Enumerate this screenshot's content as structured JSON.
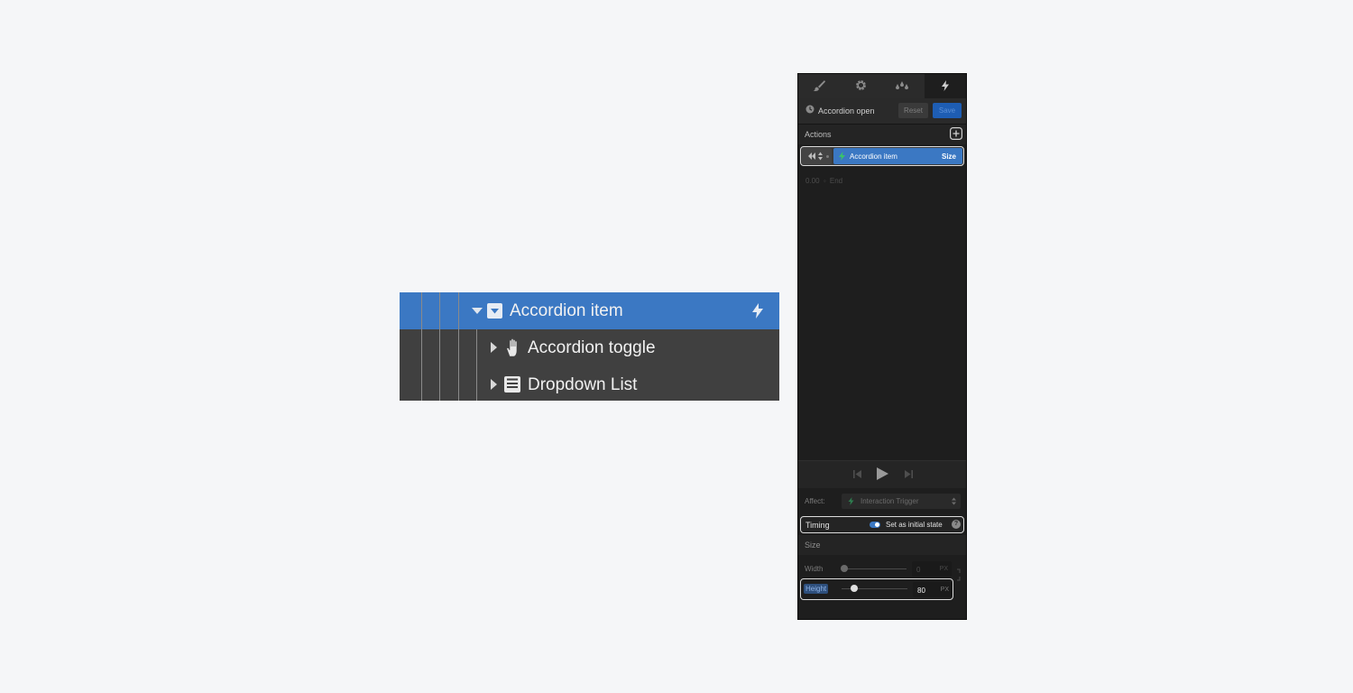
{
  "navigator": {
    "items": [
      {
        "label": "Accordion item",
        "icon": "dropdown-element-icon",
        "selected": true,
        "has_interaction": true
      },
      {
        "label": "Accordion toggle",
        "icon": "hand-pointer-icon",
        "selected": false
      },
      {
        "label": "Dropdown List",
        "icon": "dropdown-list-icon",
        "selected": false
      }
    ]
  },
  "panel": {
    "tabs": [
      {
        "icon": "brush-icon",
        "name": "Style"
      },
      {
        "icon": "gear-icon",
        "name": "Settings"
      },
      {
        "icon": "droplets-icon",
        "name": "Style manager"
      },
      {
        "icon": "lightning-icon",
        "name": "Interactions",
        "active": true
      }
    ],
    "trigger": {
      "icon": "clock-icon",
      "name": "Accordion open",
      "reset_label": "Reset",
      "save_label": "Save"
    },
    "actions": {
      "title": "Actions",
      "add_icon": "plus-square-icon",
      "item": {
        "target": "Accordion item",
        "property": "Size"
      }
    },
    "timeline": {
      "start": "0.00",
      "separator": "◦",
      "end": "End"
    },
    "affect": {
      "label": "Affect:",
      "value": "Interaction Trigger"
    },
    "timing": {
      "label": "Timing",
      "initial_state_label": "Set as initial state",
      "initial_state_on": true
    },
    "size": {
      "title": "Size",
      "width": {
        "label": "Width",
        "value": "0",
        "unit": "PX"
      },
      "height": {
        "label": "Height",
        "value": "80",
        "unit": "PX"
      }
    },
    "colors": {
      "accent": "#3b78c3",
      "green": "#3ac26b",
      "panel": "#1e1e1e"
    }
  }
}
